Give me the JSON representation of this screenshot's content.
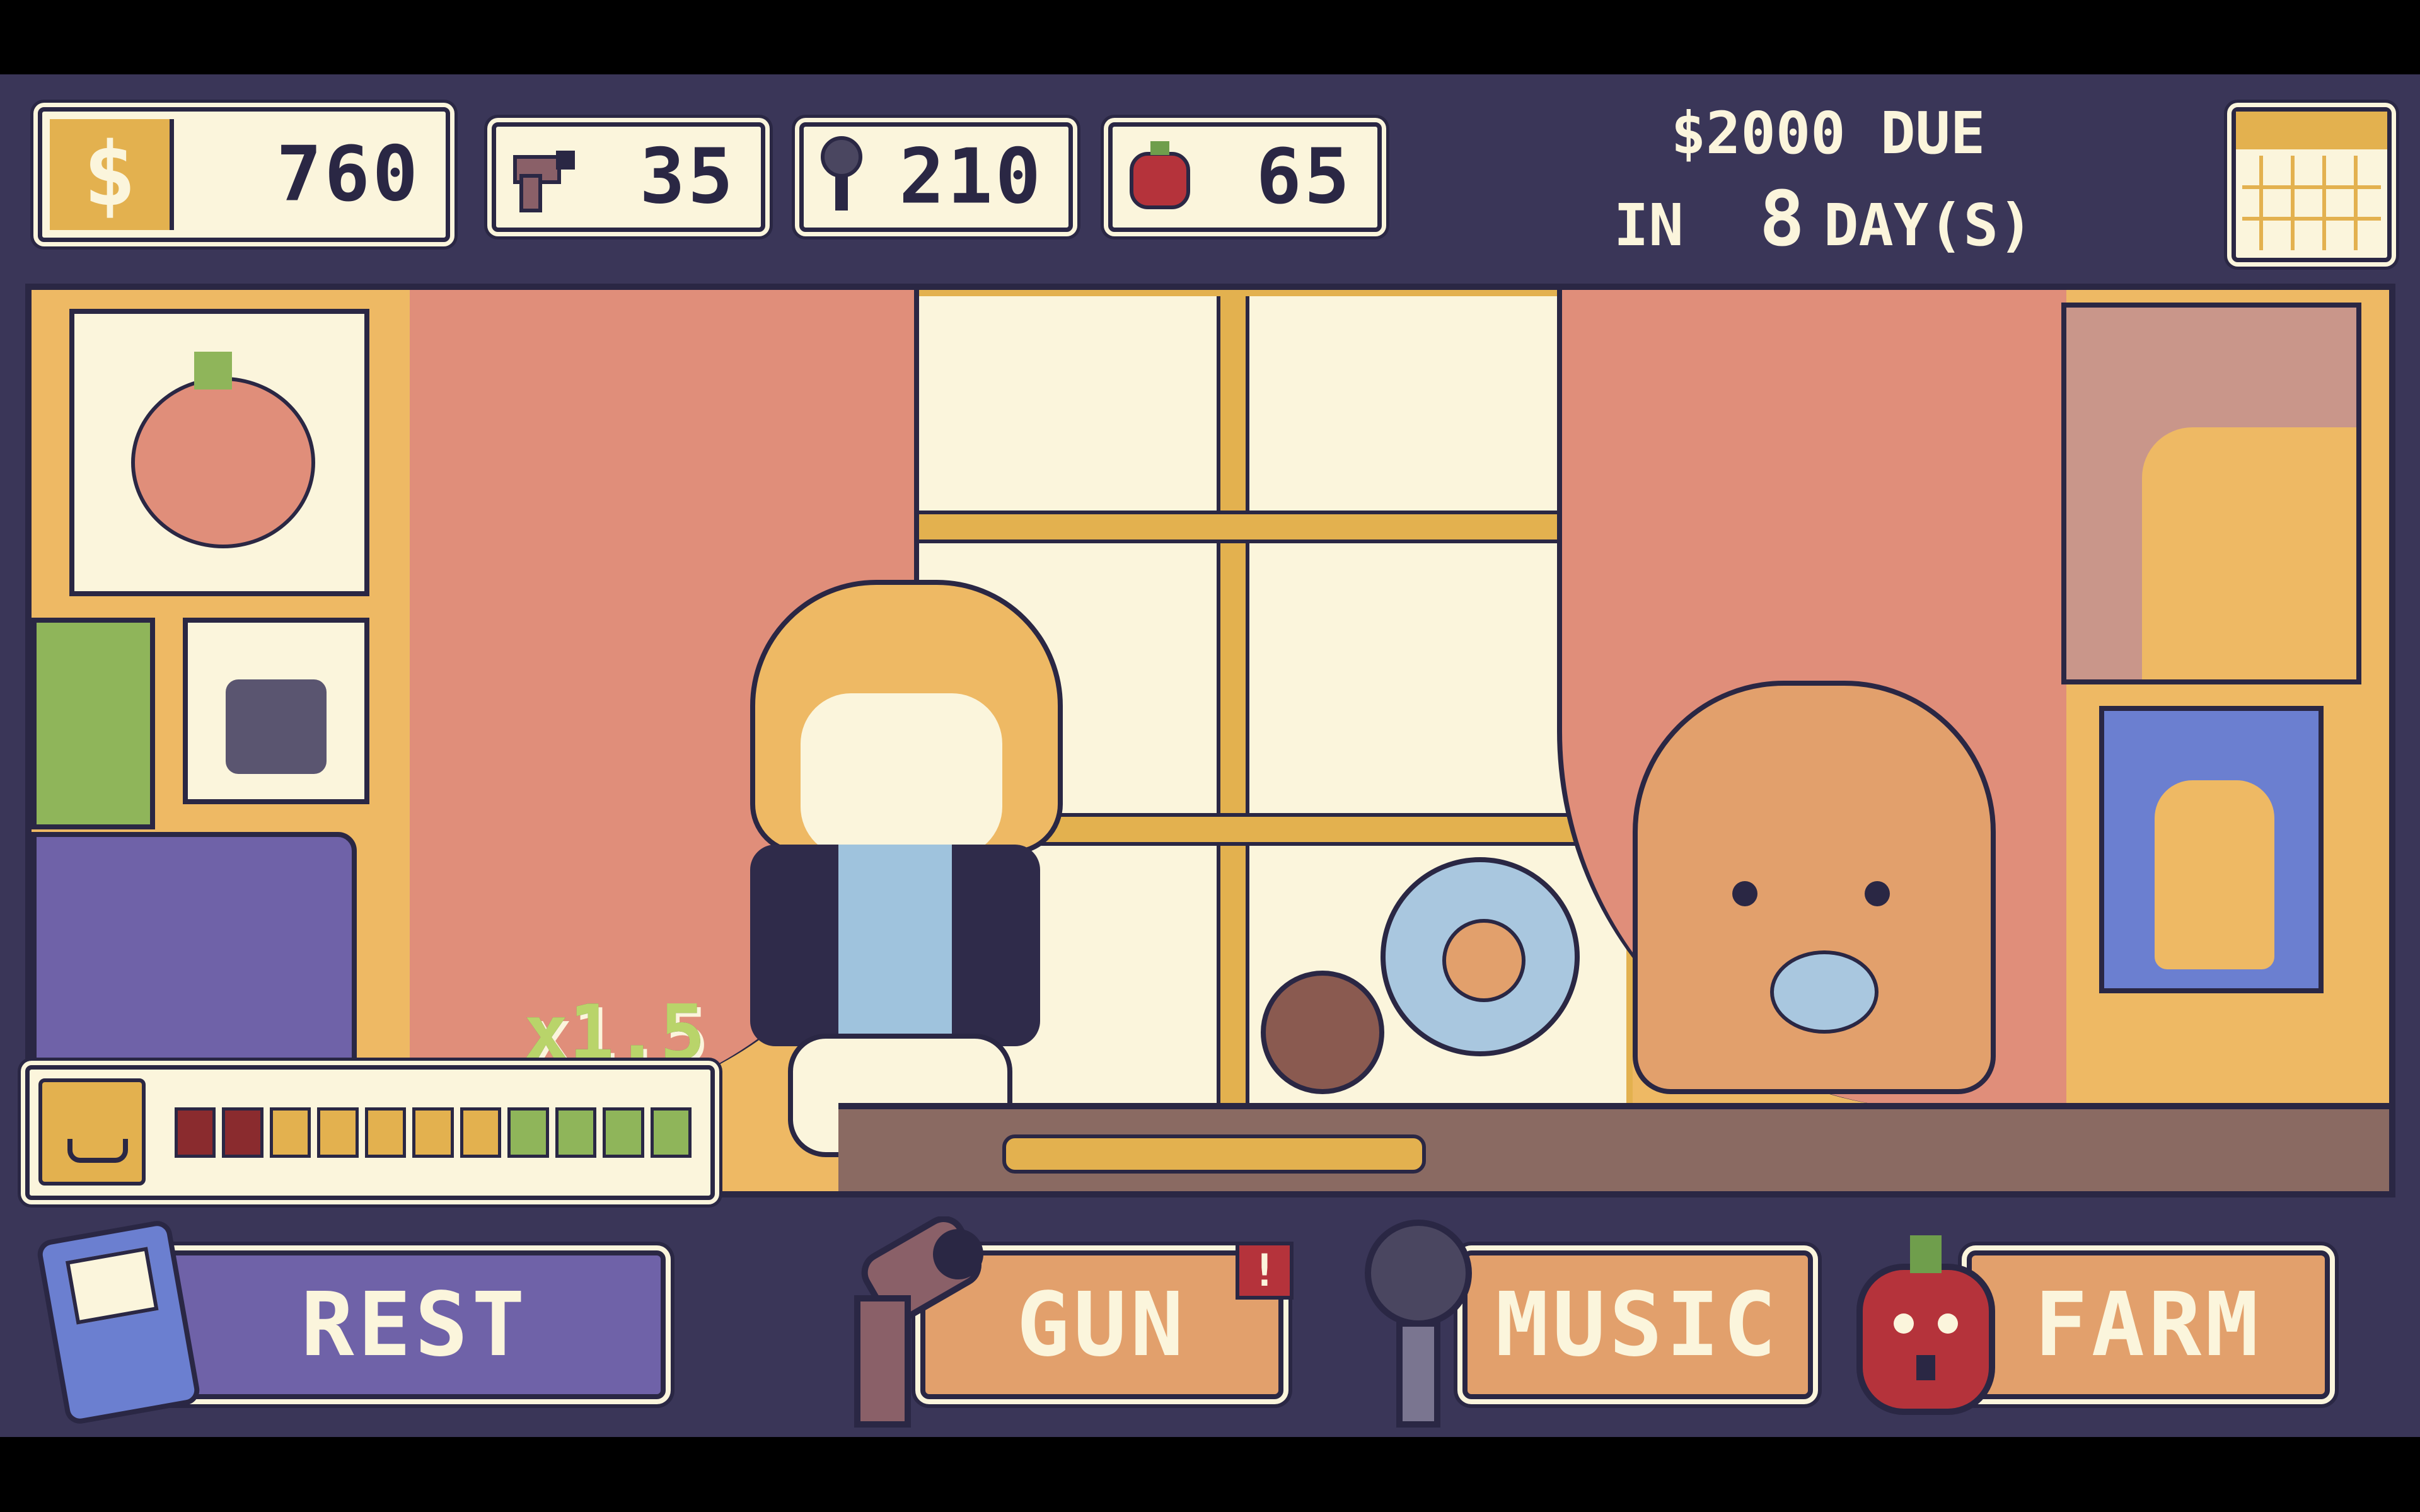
{
  "hud": {
    "money": {
      "icon": "dollar-icon",
      "symbol": "$",
      "value": "760"
    },
    "guns": {
      "icon": "gun-icon",
      "value": "35"
    },
    "music": {
      "icon": "microphone-icon",
      "value": "210"
    },
    "tomatoes": {
      "icon": "tomato-icon",
      "value": "65"
    },
    "due": {
      "line1": "$2000 DUE",
      "in_label": "IN",
      "days": "8",
      "days_label": "DAY(S)"
    },
    "calendar": {
      "icon": "calendar-icon"
    }
  },
  "scene": {
    "multiplier": "x1.5",
    "mood_icon": "smiley-icon",
    "energy_segments": [
      "#8a2b2e",
      "#8a2b2e",
      "#e3b14f",
      "#e3b14f",
      "#e3b14f",
      "#e3b14f",
      "#e3b14f",
      "#8fb55a",
      "#8fb55a",
      "#8fb55a",
      "#8fb55a"
    ],
    "energy_level": 1.0
  },
  "actions": {
    "rest": {
      "label": "REST",
      "icon": "handheld-console-icon"
    },
    "gun": {
      "label": "GUN",
      "icon": "gun-icon",
      "alert": "!"
    },
    "music": {
      "label": "MUSIC",
      "icon": "microphone-icon"
    },
    "farm": {
      "label": "FARM",
      "icon": "tomato-icon"
    }
  },
  "colors": {
    "background": "#3a3658",
    "panel": "#fbf5dc",
    "outline": "#2a2744",
    "gold": "#e3b14f",
    "salmon": "#e08e7a",
    "rest_button": "#6f62a8",
    "action_button": "#e2a06c",
    "alert": "#b5333b"
  }
}
